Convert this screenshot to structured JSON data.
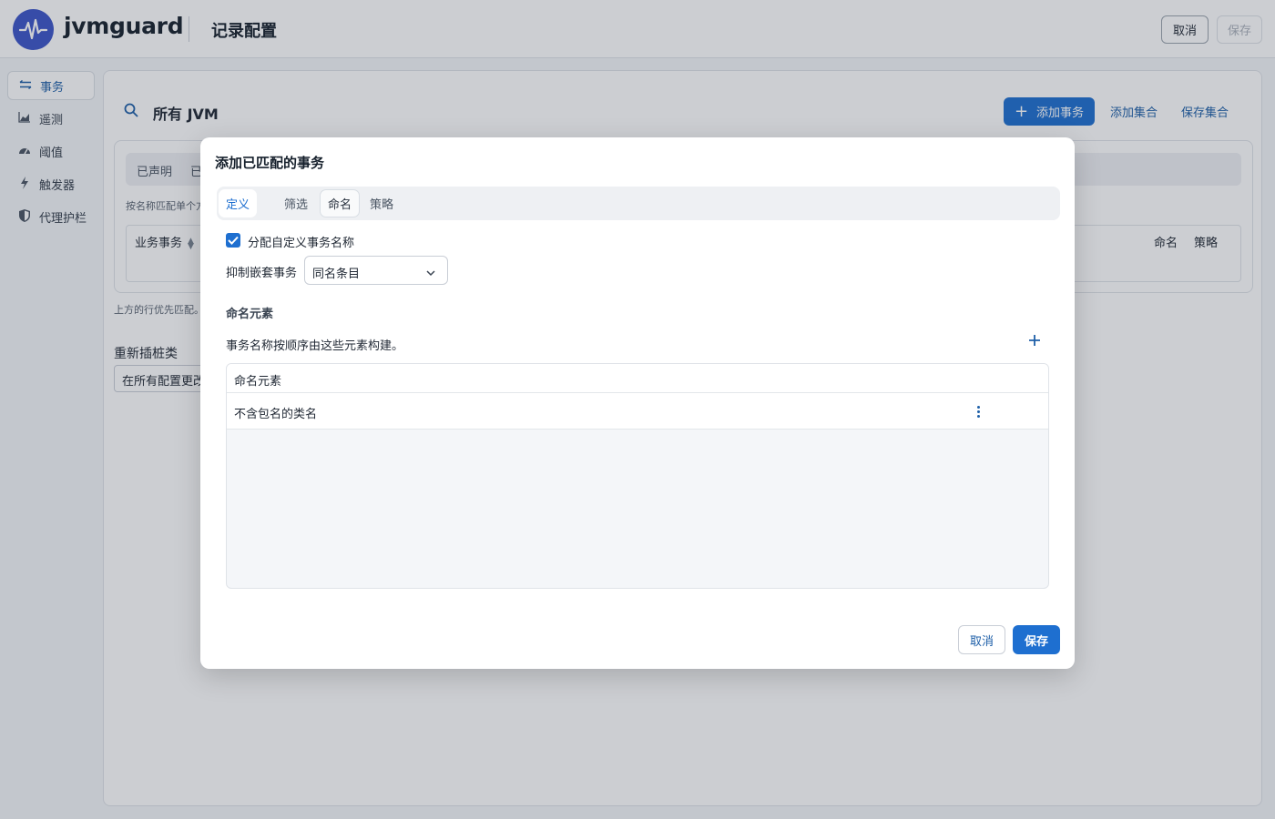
{
  "header": {
    "brand": "jvmguard",
    "page_title": "记录配置",
    "cancel_label": "取消",
    "save_label": "保存"
  },
  "sidebar": {
    "items": [
      {
        "label": "事务",
        "icon": "transactions-icon",
        "active": true
      },
      {
        "label": "遥测",
        "icon": "telemetry-icon"
      },
      {
        "label": "阈值",
        "icon": "gauge-icon"
      },
      {
        "label": "触发器",
        "icon": "lightning-icon"
      },
      {
        "label": "代理护栏",
        "icon": "shield-icon"
      }
    ]
  },
  "main": {
    "scope_title": "所有 JVM",
    "add_transaction_label": "添加事务",
    "add_set_label": "添加集合",
    "save_set_label": "保存集合",
    "tabs": [
      "已声明",
      "已"
    ],
    "hint": "按名称匹配单个方",
    "table_columns": {
      "business": "业务事务",
      "naming": "命名",
      "strategy": "策略"
    },
    "bottom_note": "上方的行优先匹配。",
    "reinstrument_label": "重新插桩类",
    "reinstrument_value": "在所有配置更改"
  },
  "dialog": {
    "title": "添加已匹配的事务",
    "tabs": [
      "定义",
      "筛选",
      "命名",
      "策略"
    ],
    "active_tab": "定义",
    "assign_custom_name_label": "分配自定义事务名称",
    "assign_custom_name_checked": true,
    "suppress_label": "抑制嵌套事务",
    "suppress_value": "同名条目",
    "naming_section_title": "命名元素",
    "naming_description": "事务名称按顺序由这些元素构建。",
    "table_header": "命名元素",
    "rows": [
      "不含包名的类名"
    ],
    "cancel_label": "取消",
    "save_label": "保存"
  },
  "colors": {
    "accent": "#1e6fd0",
    "logo": "#3c55c8",
    "link": "#1e5fa8"
  }
}
